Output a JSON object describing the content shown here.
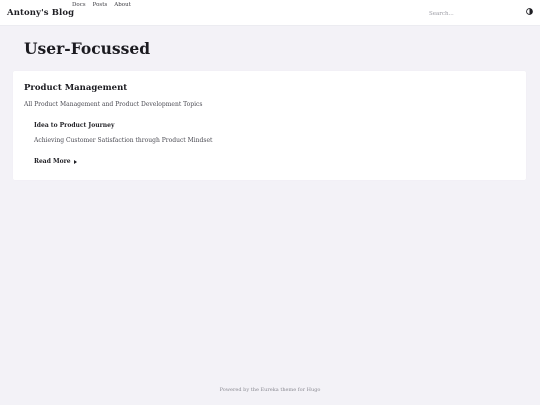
{
  "navbar": {
    "brand": "Antony's Blog",
    "links": [
      "Docs",
      "Posts",
      "About"
    ],
    "search_placeholder": "Search...",
    "theme_toggle_icon": "contrast-icon"
  },
  "page": {
    "title": "User-Focussed"
  },
  "card": {
    "title": "Product Management",
    "description": "All Product Management and Product Development Topics",
    "post": {
      "title": "Idea to Product Journey",
      "summary": "Achieving Customer Satisfaction through Product Mindset",
      "read_more": "Read More",
      "read_more_icon": "caret-right-icon"
    }
  },
  "footer": {
    "text": "Powered by the Eureka theme for Hugo"
  }
}
